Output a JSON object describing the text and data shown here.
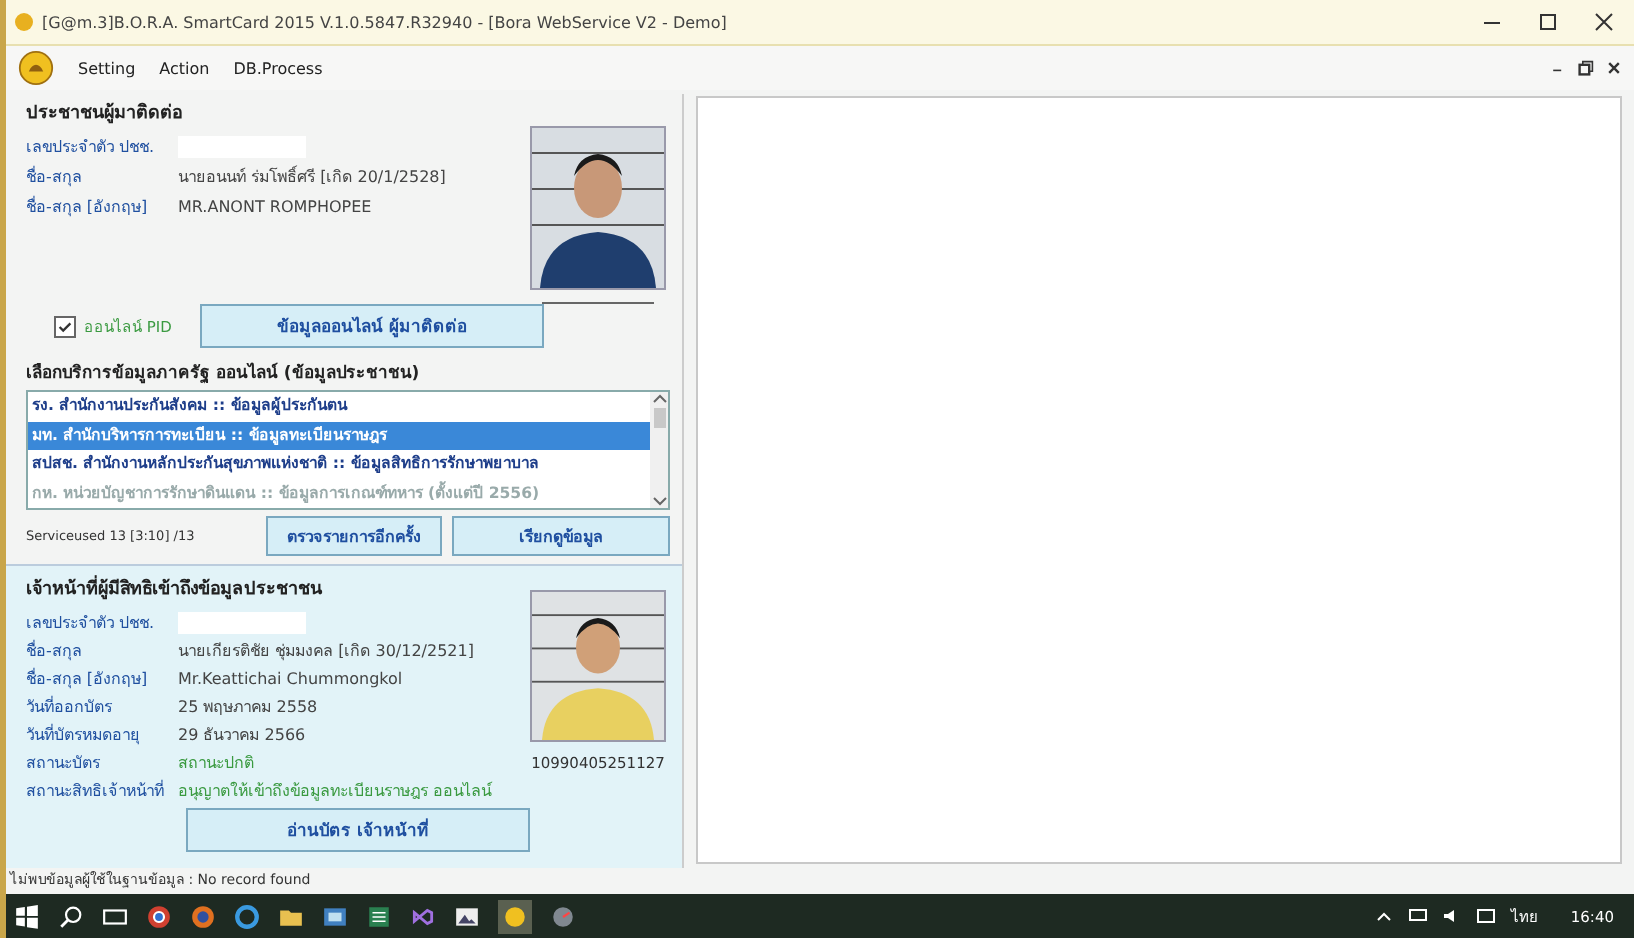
{
  "window": {
    "title": "[G@m.3]B.O.R.A. SmartCard 2015 V.1.0.5847.R32940 - [Bora WebService V2 - Demo]"
  },
  "menu": [
    "Setting",
    "Action",
    "DB.Process"
  ],
  "citizen": {
    "heading": "ประชาชนผู้มาติดต่อ",
    "fields": [
      {
        "label": "เลขประจำตัว ปชช.",
        "redacted": true
      },
      {
        "label": "ชื่อ-สกุล",
        "value": "นายอนนท์ ร่มโพธิ์ศรี [เกิด 20/1/2528]"
      },
      {
        "label": "ชื่อ-สกุล [อังกฤษ]",
        "value": "MR.ANONT ROMPHOPEE"
      }
    ],
    "online_pid": {
      "label": "ออนไลน์ PID",
      "checked": true
    },
    "online_button": "ข้อมูลออนไลน์ ผู้มาติดต่อ"
  },
  "services": {
    "label": "เลือกบริการข้อมูลภาครัฐ ออนไลน์ (ข้อมูลประชาชน)",
    "items": [
      {
        "text": "รง. สำนักงานประกันสังคม :: ข้อมูลผู้ประกันตน",
        "selected": false,
        "disabled": false
      },
      {
        "text": "มท. สำนักบริหารการทะเบียน :: ข้อมูลทะเบียนราษฎร",
        "selected": true,
        "disabled": false
      },
      {
        "text": "สปสช. สำนักงานหลักประกันสุขภาพแห่งชาติ :: ข้อมูลสิทธิการรักษาพยาบาล",
        "selected": false,
        "disabled": false
      },
      {
        "text": "กห. หน่วยบัญชาการรักษาดินแดน :: ข้อมูลการเกณฑ์ทหาร (ตั้งแต่ปี 2556)",
        "selected": false,
        "disabled": true
      }
    ],
    "usage": "Serviceused 13 [3:10] /13",
    "buttons": [
      "ตรวจรายการอีกครั้ง",
      "เรียกดูข้อมูล"
    ]
  },
  "officer": {
    "heading": "เจ้าหน้าที่ผู้มีสิทธิเข้าถึงข้อมูลประชาชน",
    "fields": [
      {
        "label": "เลขประจำตัว ปชช.",
        "redacted": true
      },
      {
        "label": "ชื่อ-สกุล",
        "value": "นายเกียรติชัย ชุ่มมงคล [เกิด 30/12/2521]",
        "kind": "text"
      },
      {
        "label": "ชื่อ-สกุล [อังกฤษ]",
        "value": "Mr.Keattichai Chummongkol",
        "kind": "text"
      },
      {
        "label": "วันที่ออกบัตร",
        "value": "25 พฤษภาคม 2558",
        "kind": "text"
      },
      {
        "label": "วันที่บัตรหมดอายุ",
        "value": "29 ธันวาคม 2566",
        "kind": "text"
      },
      {
        "label": "สถานะบัตร",
        "value": "สถานะปกติ",
        "kind": "status"
      },
      {
        "label": "สถานะสิทธิเจ้าหน้าที่",
        "value": "อนุญาตให้เข้าถึงข้อมูลทะเบียนราษฎร ออนไลน์",
        "kind": "status"
      }
    ],
    "card_number": "10990405251127",
    "read_button": "อ่านบัตร เจ้าหน้าที่"
  },
  "status_bar": "ไม่พบข้อมูลผู้ใช้ในฐานข้อมูล : No record found",
  "taskbar": {
    "language": "ไทย",
    "time": "16:40"
  }
}
